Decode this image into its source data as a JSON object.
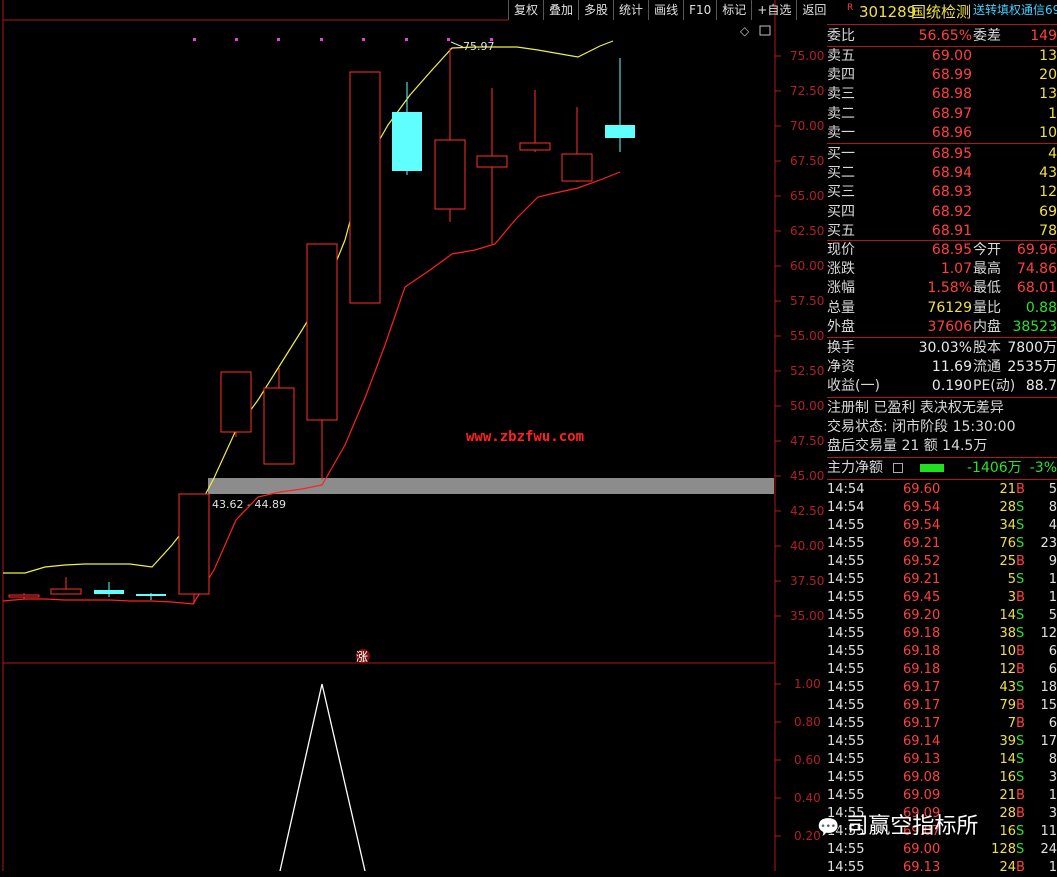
{
  "toolbar": [
    "复权",
    "叠加",
    "多股",
    "统计",
    "画线",
    "F10",
    "标记",
    "+自选",
    "返回"
  ],
  "chart": {
    "url_text": "www.zbzfwu.com",
    "high_label": "75.97",
    "band_label": "43.62 - 44.89",
    "zhang_label": "涨",
    "price_ticks": [
      "75.00",
      "72.50",
      "70.00",
      "67.50",
      "65.00",
      "62.50",
      "60.00",
      "57.50",
      "55.00",
      "52.50",
      "50.00",
      "47.50",
      "45.00",
      "42.50",
      "40.00",
      "37.50",
      "35.00"
    ],
    "ind_ticks": [
      "1.00",
      "0.80",
      "0.60",
      "0.40",
      "0.20"
    ],
    "colors": {
      "up": "#ff3030",
      "down": "#60ffff",
      "ma": "#f0f040",
      "band": "#ff2020",
      "axis": "#b01818"
    }
  },
  "panel": {
    "r_badge": "R",
    "code": "301289",
    "name": "国统检测",
    "ticker_tags": "送转填权通信69",
    "weibi_label": "委比",
    "weibi_value": "56.65%",
    "weicha_label": "委差",
    "weicha_value": "149",
    "asks": [
      {
        "label": "卖五",
        "price": "69.00",
        "vol": "13"
      },
      {
        "label": "卖四",
        "price": "68.99",
        "vol": "20"
      },
      {
        "label": "卖三",
        "price": "68.98",
        "vol": "13"
      },
      {
        "label": "卖二",
        "price": "68.97",
        "vol": "1"
      },
      {
        "label": "卖一",
        "price": "68.96",
        "vol": "10"
      }
    ],
    "bids": [
      {
        "label": "买一",
        "price": "68.95",
        "vol": "4"
      },
      {
        "label": "买二",
        "price": "68.94",
        "vol": "43"
      },
      {
        "label": "买三",
        "price": "68.93",
        "vol": "12"
      },
      {
        "label": "买四",
        "price": "68.92",
        "vol": "69"
      },
      {
        "label": "买五",
        "price": "68.91",
        "vol": "78"
      }
    ],
    "stats": [
      {
        "l1": "现价",
        "v1": "68.95",
        "c1": "red",
        "l2": "今开",
        "v2": "69.96",
        "c2": "red"
      },
      {
        "l1": "涨跌",
        "v1": "1.07",
        "c1": "red",
        "l2": "最高",
        "v2": "74.86",
        "c2": "red"
      },
      {
        "l1": "涨幅",
        "v1": "1.58%",
        "c1": "red",
        "l2": "最低",
        "v2": "68.01",
        "c2": "red"
      },
      {
        "l1": "总量",
        "v1": "76129",
        "c1": "yellow",
        "l2": "量比",
        "v2": "0.88",
        "c2": "green"
      },
      {
        "l1": "外盘",
        "v1": "37606",
        "c1": "red",
        "l2": "内盘",
        "v2": "38523",
        "c2": "green"
      }
    ],
    "stats2": [
      {
        "l1": "换手",
        "v1": "30.03%",
        "c1": "white",
        "l2": "股本",
        "v2": "7800万",
        "c2": "white"
      },
      {
        "l1": "净资",
        "v1": "11.69",
        "c1": "white",
        "l2": "流通",
        "v2": "2535万",
        "c2": "white"
      },
      {
        "l1": "收益(一)",
        "v1": "0.190",
        "c1": "white",
        "l2": "PE(动)",
        "v2": "88.7",
        "c2": "white"
      }
    ],
    "info1": "注册制 已盈利 表决权无差异",
    "info2": "交易状态: 闭市阶段 15:30:00",
    "info3": "盘后交易量 21 额 14.5万",
    "main_label": "主力净额",
    "main_value": "-1406万",
    "main_pct": "-3%",
    "ticks": [
      {
        "t": "14:54",
        "p": "69.60",
        "v": "21",
        "bs": "B",
        "n": "5"
      },
      {
        "t": "14:54",
        "p": "69.54",
        "v": "28",
        "bs": "S",
        "n": "8"
      },
      {
        "t": "14:55",
        "p": "69.54",
        "v": "34",
        "bs": "S",
        "n": "4"
      },
      {
        "t": "14:55",
        "p": "69.21",
        "v": "76",
        "bs": "S",
        "n": "23"
      },
      {
        "t": "14:55",
        "p": "69.52",
        "v": "25",
        "bs": "B",
        "n": "9"
      },
      {
        "t": "14:55",
        "p": "69.21",
        "v": "5",
        "bs": "S",
        "n": "1"
      },
      {
        "t": "14:55",
        "p": "69.45",
        "v": "3",
        "bs": "B",
        "n": "1"
      },
      {
        "t": "14:55",
        "p": "69.20",
        "v": "14",
        "bs": "S",
        "n": "5"
      },
      {
        "t": "14:55",
        "p": "69.18",
        "v": "38",
        "bs": "S",
        "n": "12"
      },
      {
        "t": "14:55",
        "p": "69.18",
        "v": "10",
        "bs": "B",
        "n": "6"
      },
      {
        "t": "14:55",
        "p": "69.18",
        "v": "12",
        "bs": "B",
        "n": "6"
      },
      {
        "t": "14:55",
        "p": "69.17",
        "v": "43",
        "bs": "S",
        "n": "18"
      },
      {
        "t": "14:55",
        "p": "69.17",
        "v": "79",
        "bs": "B",
        "n": "15"
      },
      {
        "t": "14:55",
        "p": "69.17",
        "v": "7",
        "bs": "B",
        "n": "6"
      },
      {
        "t": "14:55",
        "p": "69.14",
        "v": "39",
        "bs": "S",
        "n": "17"
      },
      {
        "t": "14:55",
        "p": "69.13",
        "v": "14",
        "bs": "S",
        "n": "8"
      },
      {
        "t": "14:55",
        "p": "69.08",
        "v": "16",
        "bs": "S",
        "n": "3"
      },
      {
        "t": "14:55",
        "p": "69.09",
        "v": "21",
        "bs": "B",
        "n": "1"
      },
      {
        "t": "14:55",
        "p": "69.09",
        "v": "28",
        "bs": "B",
        "n": "3"
      },
      {
        "t": "14:55",
        "p": "69.07",
        "v": "16",
        "bs": "S",
        "n": "11"
      },
      {
        "t": "14:55",
        "p": "69.00",
        "v": "128",
        "bs": "S",
        "n": "24"
      },
      {
        "t": "14:55",
        "p": "69.13",
        "v": "24",
        "bs": "B",
        "n": "1"
      }
    ],
    "watermark": "司赢空指标所"
  }
}
